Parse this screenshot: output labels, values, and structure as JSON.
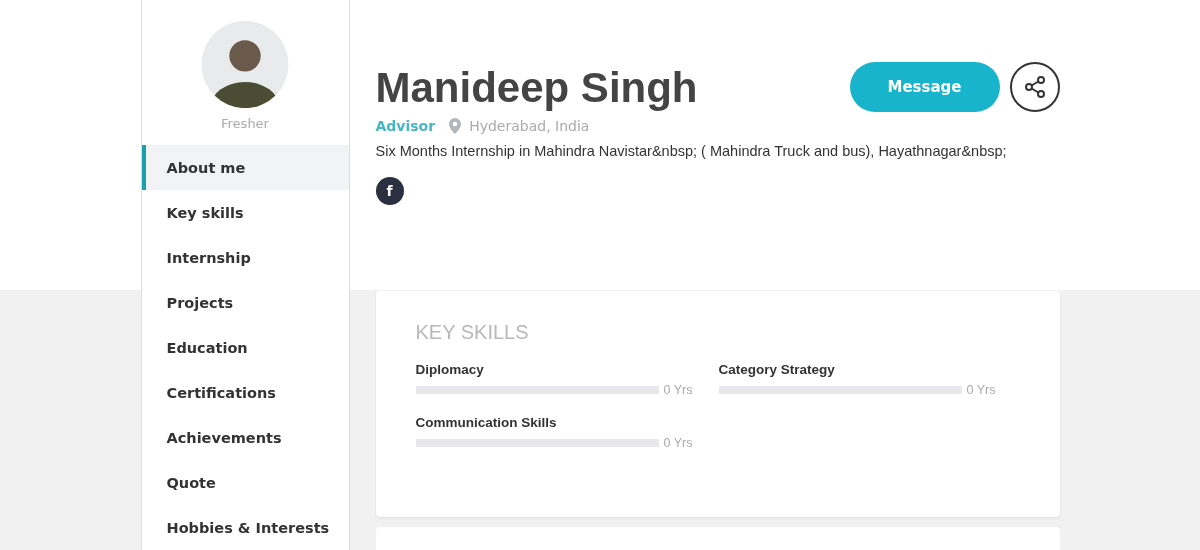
{
  "sidebar": {
    "status": "Fresher",
    "items": [
      {
        "label": "About me",
        "selected": true
      },
      {
        "label": "Key skills",
        "selected": false
      },
      {
        "label": "Internship",
        "selected": false
      },
      {
        "label": "Projects",
        "selected": false
      },
      {
        "label": "Education",
        "selected": false
      },
      {
        "label": "Certifications",
        "selected": false
      },
      {
        "label": "Achievements",
        "selected": false
      },
      {
        "label": "Quote",
        "selected": false
      },
      {
        "label": "Hobbies & Interests",
        "selected": false
      }
    ]
  },
  "profile": {
    "name": "Manideep Singh",
    "role": "Advisor",
    "location": "Hyderabad, India",
    "summary": "Six Months Internship in Mahindra Navistar&nbsp; ( Mahindra Truck and bus), Hayathnagar&nbsp;",
    "social": [
      "f"
    ],
    "message_button": "Message"
  },
  "key_skills": {
    "title": "KEY SKILLS",
    "skills": [
      {
        "name": "Diplomacy",
        "level": 0,
        "reading": "0 Yrs"
      },
      {
        "name": "Category Strategy",
        "level": 0,
        "reading": "0 Yrs"
      },
      {
        "name": "Communication Skills",
        "level": 0,
        "reading": "0 Yrs"
      }
    ]
  }
}
